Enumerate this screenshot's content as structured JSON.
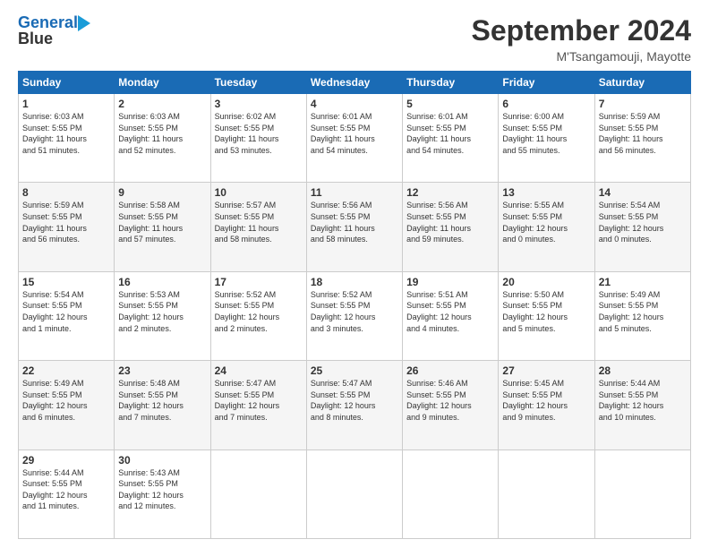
{
  "header": {
    "logo_line1": "General",
    "logo_line2": "Blue",
    "month_title": "September 2024",
    "location": "M'Tsangamouji, Mayotte"
  },
  "days_of_week": [
    "Sunday",
    "Monday",
    "Tuesday",
    "Wednesday",
    "Thursday",
    "Friday",
    "Saturday"
  ],
  "weeks": [
    [
      {
        "day": "1",
        "info": "Sunrise: 6:03 AM\nSunset: 5:55 PM\nDaylight: 11 hours\nand 51 minutes."
      },
      {
        "day": "2",
        "info": "Sunrise: 6:03 AM\nSunset: 5:55 PM\nDaylight: 11 hours\nand 52 minutes."
      },
      {
        "day": "3",
        "info": "Sunrise: 6:02 AM\nSunset: 5:55 PM\nDaylight: 11 hours\nand 53 minutes."
      },
      {
        "day": "4",
        "info": "Sunrise: 6:01 AM\nSunset: 5:55 PM\nDaylight: 11 hours\nand 54 minutes."
      },
      {
        "day": "5",
        "info": "Sunrise: 6:01 AM\nSunset: 5:55 PM\nDaylight: 11 hours\nand 54 minutes."
      },
      {
        "day": "6",
        "info": "Sunrise: 6:00 AM\nSunset: 5:55 PM\nDaylight: 11 hours\nand 55 minutes."
      },
      {
        "day": "7",
        "info": "Sunrise: 5:59 AM\nSunset: 5:55 PM\nDaylight: 11 hours\nand 56 minutes."
      }
    ],
    [
      {
        "day": "8",
        "info": "Sunrise: 5:59 AM\nSunset: 5:55 PM\nDaylight: 11 hours\nand 56 minutes."
      },
      {
        "day": "9",
        "info": "Sunrise: 5:58 AM\nSunset: 5:55 PM\nDaylight: 11 hours\nand 57 minutes."
      },
      {
        "day": "10",
        "info": "Sunrise: 5:57 AM\nSunset: 5:55 PM\nDaylight: 11 hours\nand 58 minutes."
      },
      {
        "day": "11",
        "info": "Sunrise: 5:56 AM\nSunset: 5:55 PM\nDaylight: 11 hours\nand 58 minutes."
      },
      {
        "day": "12",
        "info": "Sunrise: 5:56 AM\nSunset: 5:55 PM\nDaylight: 11 hours\nand 59 minutes."
      },
      {
        "day": "13",
        "info": "Sunrise: 5:55 AM\nSunset: 5:55 PM\nDaylight: 12 hours\nand 0 minutes."
      },
      {
        "day": "14",
        "info": "Sunrise: 5:54 AM\nSunset: 5:55 PM\nDaylight: 12 hours\nand 0 minutes."
      }
    ],
    [
      {
        "day": "15",
        "info": "Sunrise: 5:54 AM\nSunset: 5:55 PM\nDaylight: 12 hours\nand 1 minute."
      },
      {
        "day": "16",
        "info": "Sunrise: 5:53 AM\nSunset: 5:55 PM\nDaylight: 12 hours\nand 2 minutes."
      },
      {
        "day": "17",
        "info": "Sunrise: 5:52 AM\nSunset: 5:55 PM\nDaylight: 12 hours\nand 2 minutes."
      },
      {
        "day": "18",
        "info": "Sunrise: 5:52 AM\nSunset: 5:55 PM\nDaylight: 12 hours\nand 3 minutes."
      },
      {
        "day": "19",
        "info": "Sunrise: 5:51 AM\nSunset: 5:55 PM\nDaylight: 12 hours\nand 4 minutes."
      },
      {
        "day": "20",
        "info": "Sunrise: 5:50 AM\nSunset: 5:55 PM\nDaylight: 12 hours\nand 5 minutes."
      },
      {
        "day": "21",
        "info": "Sunrise: 5:49 AM\nSunset: 5:55 PM\nDaylight: 12 hours\nand 5 minutes."
      }
    ],
    [
      {
        "day": "22",
        "info": "Sunrise: 5:49 AM\nSunset: 5:55 PM\nDaylight: 12 hours\nand 6 minutes."
      },
      {
        "day": "23",
        "info": "Sunrise: 5:48 AM\nSunset: 5:55 PM\nDaylight: 12 hours\nand 7 minutes."
      },
      {
        "day": "24",
        "info": "Sunrise: 5:47 AM\nSunset: 5:55 PM\nDaylight: 12 hours\nand 7 minutes."
      },
      {
        "day": "25",
        "info": "Sunrise: 5:47 AM\nSunset: 5:55 PM\nDaylight: 12 hours\nand 8 minutes."
      },
      {
        "day": "26",
        "info": "Sunrise: 5:46 AM\nSunset: 5:55 PM\nDaylight: 12 hours\nand 9 minutes."
      },
      {
        "day": "27",
        "info": "Sunrise: 5:45 AM\nSunset: 5:55 PM\nDaylight: 12 hours\nand 9 minutes."
      },
      {
        "day": "28",
        "info": "Sunrise: 5:44 AM\nSunset: 5:55 PM\nDaylight: 12 hours\nand 10 minutes."
      }
    ],
    [
      {
        "day": "29",
        "info": "Sunrise: 5:44 AM\nSunset: 5:55 PM\nDaylight: 12 hours\nand 11 minutes."
      },
      {
        "day": "30",
        "info": "Sunrise: 5:43 AM\nSunset: 5:55 PM\nDaylight: 12 hours\nand 12 minutes."
      },
      {
        "day": "",
        "info": ""
      },
      {
        "day": "",
        "info": ""
      },
      {
        "day": "",
        "info": ""
      },
      {
        "day": "",
        "info": ""
      },
      {
        "day": "",
        "info": ""
      }
    ]
  ]
}
